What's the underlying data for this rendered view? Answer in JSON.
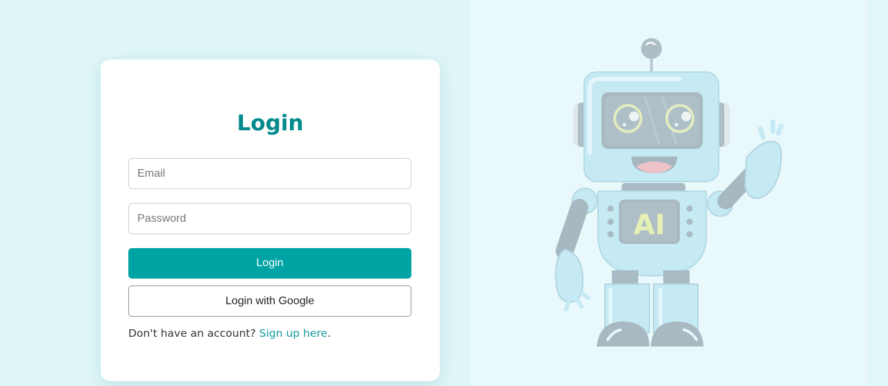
{
  "login_form": {
    "title": "Login",
    "email_placeholder": "Email",
    "password_placeholder": "Password",
    "login_button": "Login",
    "google_button": "Login with Google",
    "signup_prompt": "Don't have an account? ",
    "signup_link": "Sign up here",
    "signup_suffix": "."
  },
  "illustration": {
    "chest_label": "AI"
  },
  "colors": {
    "accent": "#00a3a4",
    "title": "#008a8c",
    "link": "#13999b",
    "background_left": "#dff6f8",
    "background_right": "#e8f8fb"
  }
}
